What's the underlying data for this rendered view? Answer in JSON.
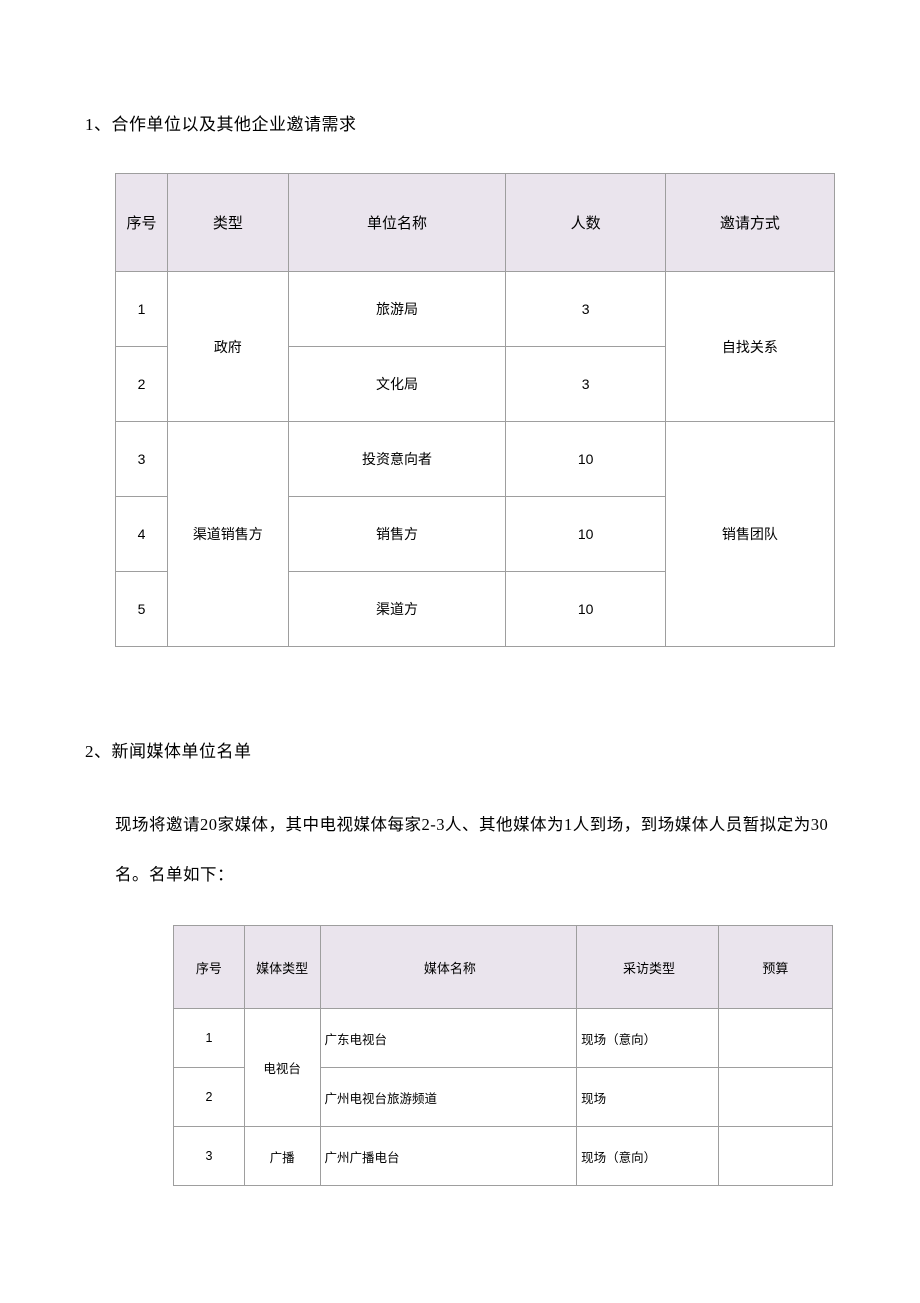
{
  "section1": {
    "heading": "1、合作单位以及其他企业邀请需求",
    "headers": {
      "seq": "序号",
      "type": "类型",
      "name": "单位名称",
      "count": "人数",
      "invite": "邀请方式"
    },
    "groups": [
      {
        "type": "政府",
        "invite": "自找关系",
        "rows": [
          {
            "seq": "1",
            "name": "旅游局",
            "count": "3"
          },
          {
            "seq": "2",
            "name": "文化局",
            "count": "3"
          }
        ]
      },
      {
        "type": "渠道销售方",
        "invite": "销售团队",
        "rows": [
          {
            "seq": "3",
            "name": "投资意向者",
            "count": "10"
          },
          {
            "seq": "4",
            "name": "销售方",
            "count": "10"
          },
          {
            "seq": "5",
            "name": "渠道方",
            "count": "10"
          }
        ]
      }
    ]
  },
  "section2": {
    "heading": "2、新闻媒体单位名单",
    "paragraph": "现场将邀请20家媒体，其中电视媒体每家2-3人、其他媒体为1人到场，到场媒体人员暂拟定为30名。名单如下：",
    "headers": {
      "seq": "序号",
      "type": "媒体类型",
      "name": "媒体名称",
      "kind": "采访类型",
      "budget": "预算"
    },
    "groups": [
      {
        "type": "电视台",
        "rows": [
          {
            "seq": "1",
            "name": "广东电视台",
            "kind": "现场（意向）",
            "budget": ""
          },
          {
            "seq": "2",
            "name": "广州电视台旅游频道",
            "kind": "现场",
            "budget": ""
          }
        ]
      },
      {
        "type": "广播",
        "rows": [
          {
            "seq": "3",
            "name": "广州广播电台",
            "kind": "现场（意向）",
            "budget": ""
          }
        ]
      }
    ]
  }
}
